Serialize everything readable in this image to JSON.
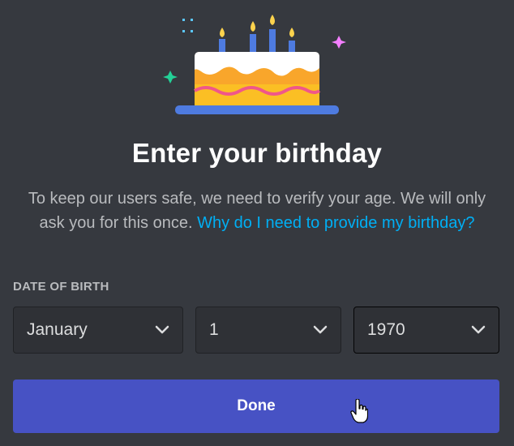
{
  "modal": {
    "title": "Enter your birthday",
    "description": "To keep our users safe, we need to verify your age. We will only ask you for this once.",
    "link_text": "Why do I need to provide my birthday?",
    "dob_label": "DATE OF BIRTH",
    "month": "January",
    "day": "1",
    "year": "1970",
    "done_label": "Done"
  },
  "colors": {
    "background": "#36393f",
    "button": "#4752c4",
    "link": "#00aff4",
    "cake_frosting": "#ffffff",
    "cake_body": "#f9a62b",
    "cake_plate": "#4e7be0",
    "wave": "#f47fff"
  },
  "icons": [
    "cake-illustration-icon",
    "chevron-down-icon",
    "hand-pointer-icon"
  ]
}
